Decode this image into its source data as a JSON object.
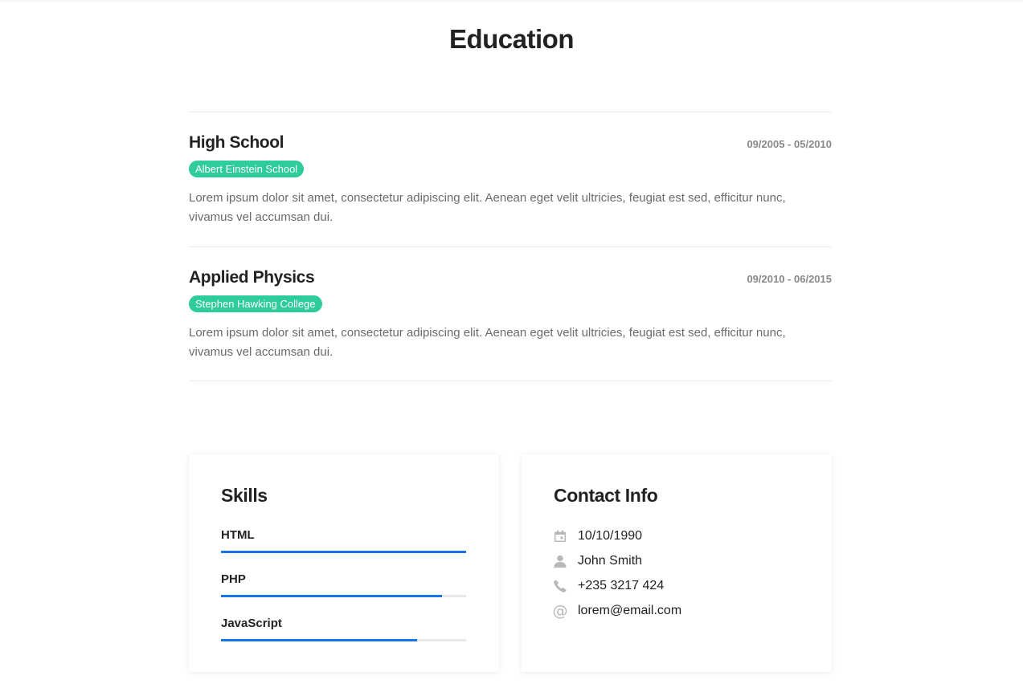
{
  "page": {
    "title": "Education"
  },
  "education": [
    {
      "title": "High School",
      "dates": "09/2005 - 05/2010",
      "school": "Albert Einstein School",
      "description": "Lorem ipsum dolor sit amet, consectetur adipiscing elit. Aenean eget velit ultricies, feugiat est sed, efficitur nunc, vivamus vel accumsan dui."
    },
    {
      "title": "Applied Physics",
      "dates": "09/2010 - 06/2015",
      "school": "Stephen Hawking College",
      "description": "Lorem ipsum dolor sit amet, consectetur adipiscing elit. Aenean eget velit ultricies, feugiat est sed, efficitur nunc, vivamus vel accumsan dui."
    }
  ],
  "skills": {
    "title": "Skills",
    "items": [
      {
        "label": "HTML",
        "level": 1.0
      },
      {
        "label": "PHP",
        "level": 0.9
      },
      {
        "label": "JavaScript",
        "level": 0.8
      }
    ]
  },
  "contact": {
    "title": "Contact Info",
    "items": [
      {
        "icon": "calendar-icon",
        "text": "10/10/1990"
      },
      {
        "icon": "user-icon",
        "text": "John Smith"
      },
      {
        "icon": "phone-icon",
        "text": "+235 3217 424"
      },
      {
        "icon": "at-icon",
        "text": "lorem@email.com"
      }
    ]
  },
  "colors": {
    "badge": "#2ecc9a",
    "skill_bar": "#1a73e8",
    "icon": "#b8b8b8"
  }
}
